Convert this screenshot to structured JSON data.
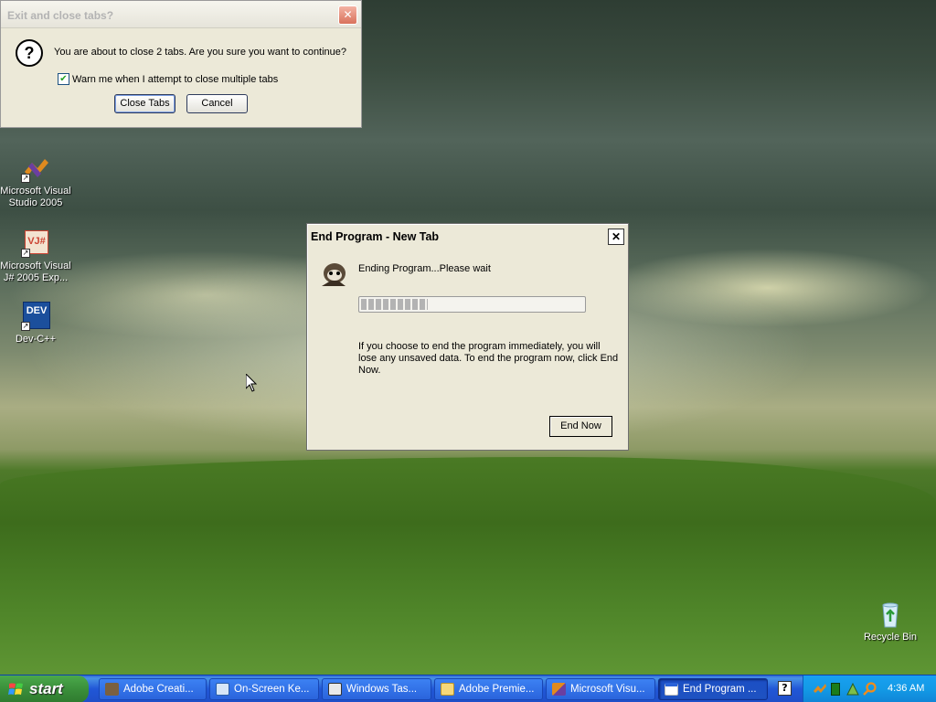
{
  "desktop": {
    "icons": [
      {
        "label_line1": "Microsoft Visual",
        "label_line2": "Studio 2005",
        "icon": "visual-studio-icon"
      },
      {
        "label_line1": "Microsoft Visual",
        "label_line2": "J# 2005 Exp...",
        "icon": "vjsharp-icon",
        "badge": "VJ#"
      },
      {
        "label_line1": "Dev-C++",
        "label_line2": "",
        "icon": "devcpp-icon",
        "badge": "DEV"
      }
    ],
    "recycle_bin": {
      "label": "Recycle Bin",
      "icon": "recycle-bin-icon"
    }
  },
  "close_tabs_dialog": {
    "title": "Exit and close tabs?",
    "close_glyph": "✕",
    "icon_glyph": "?",
    "message": "You are about to close 2 tabs. Are you sure you want to continue?",
    "checkbox_label": "Warn me when I attempt to close multiple tabs",
    "checkbox_checked": true,
    "check_glyph": "✔",
    "close_tabs_button": "Close Tabs",
    "cancel_button": "Cancel"
  },
  "end_program_dialog": {
    "title": "End Program - New Tab",
    "close_glyph": "✕",
    "status": "Ending Program...Please wait",
    "progress_fraction": 0.3,
    "description": "If you choose to end the program immediately, you will lose any unsaved data. To end the program now, click End Now.",
    "end_now_button": "End Now"
  },
  "taskbar": {
    "start_label": "start",
    "buttons": [
      {
        "label": "Adobe Creati...",
        "icon": "adobe-icon",
        "active": false
      },
      {
        "label": "On-Screen Ke...",
        "icon": "keyboard-icon",
        "active": false
      },
      {
        "label": "Windows Tas...",
        "icon": "task-manager-icon",
        "active": false
      },
      {
        "label": "Adobe Premie...",
        "icon": "folder-icon",
        "active": false
      },
      {
        "label": "Microsoft Visu...",
        "icon": "visual-studio-icon",
        "active": false
      },
      {
        "label": "End Program ...",
        "icon": "window-icon",
        "active": true
      }
    ],
    "help_glyph": "?",
    "clock": "4:36 AM"
  },
  "colors": {
    "dialog_bg": "#ece9d8",
    "taskbar_blue": "#2157d7",
    "start_green": "#3a8f3a",
    "tray_blue": "#139ae6",
    "title_dark": "#000000"
  }
}
